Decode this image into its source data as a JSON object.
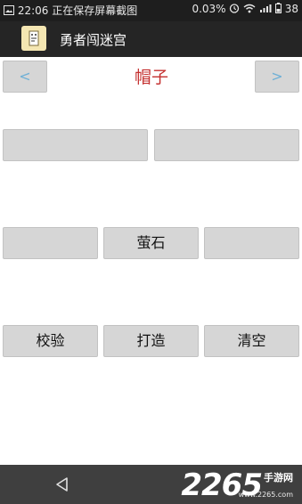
{
  "status_bar": {
    "time": "22:06",
    "notification": "正在保存屏幕截图",
    "speed": "0.03%",
    "battery": "38"
  },
  "app": {
    "title": "勇者闯迷宫"
  },
  "nav": {
    "prev_label": "<",
    "next_label": ">",
    "category": "帽子"
  },
  "slots_row1": [
    "",
    ""
  ],
  "slots_row2": [
    "",
    "萤石",
    ""
  ],
  "actions": {
    "verify": "校验",
    "forge": "打造",
    "clear": "清空"
  },
  "watermark": {
    "brand": "2265",
    "sub": "手游网",
    "url": "www.2265.com"
  },
  "icons": [
    "screenshot-icon",
    "alarm-icon",
    "wifi-icon",
    "signal-icon",
    "battery-icon",
    "app-logo-icon",
    "back-icon"
  ]
}
